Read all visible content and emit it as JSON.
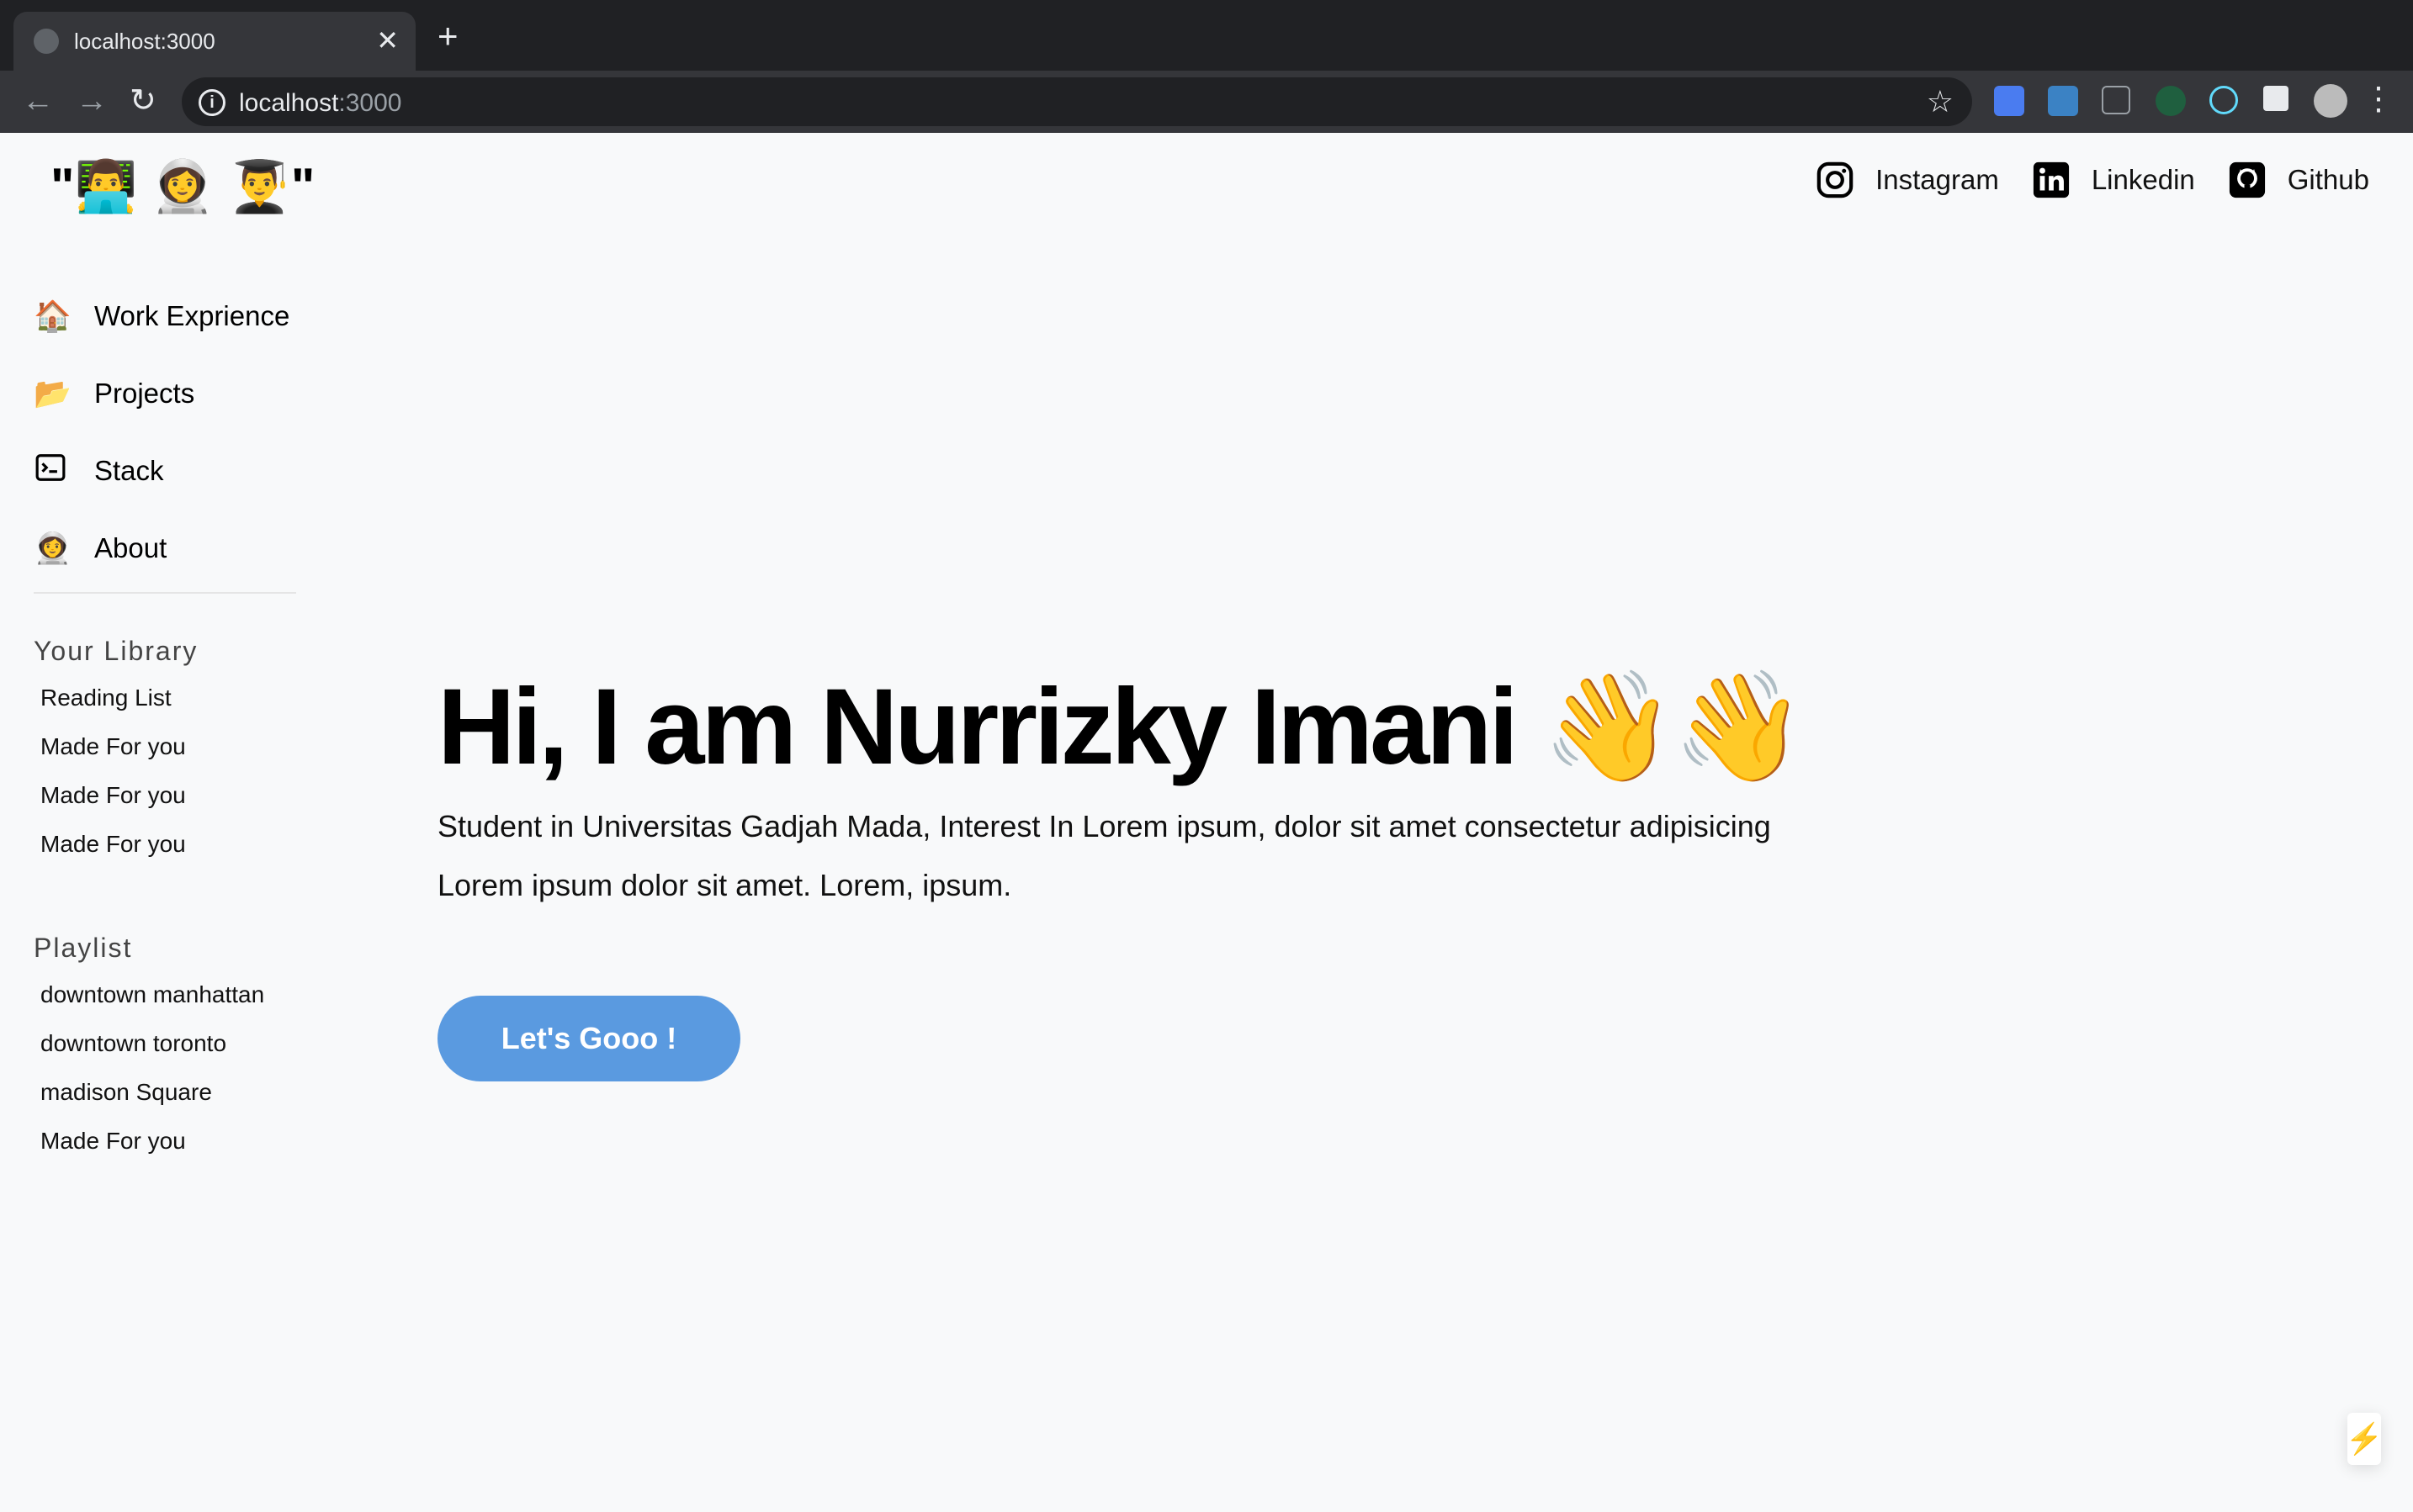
{
  "browser": {
    "tab_title": "localhost:3000",
    "tab_close": "✕",
    "new_tab": "+",
    "url_host": "localhost",
    "url_port": ":3000",
    "back_icon": "←",
    "forward_icon": "→",
    "reload_icon": "↻",
    "info_icon": "i",
    "star_icon": "☆",
    "menu_icon": "⋮"
  },
  "logo": {
    "open_quote": "\"",
    "emojis": "👨‍💻 👩‍🚀 👨‍🎓",
    "close_quote": "\""
  },
  "socials": [
    {
      "label": "Instagram",
      "icon": "instagram-icon"
    },
    {
      "label": "Linkedin",
      "icon": "linkedin-icon"
    },
    {
      "label": "Github",
      "icon": "github-icon"
    }
  ],
  "nav": [
    {
      "emoji": "🏠",
      "label": "Work Exprience"
    },
    {
      "emoji": "📂",
      "label": "Projects"
    },
    {
      "emoji": "⌨",
      "label": "Stack"
    },
    {
      "emoji": "👩‍🚀",
      "label": "About"
    }
  ],
  "library": {
    "title": "Your Library",
    "items": [
      "Reading List",
      "Made For you",
      "Made For you",
      "Made For you"
    ]
  },
  "playlist": {
    "title": "Playlist",
    "items": [
      "downtown manhattan",
      "downtown toronto",
      "madison Square",
      "Made For you"
    ]
  },
  "hero": {
    "title": "Hi, I am Nurrizky Imani 👋👋",
    "line1": "Student in Universitas Gadjah Mada, Interest In Lorem ipsum, dolor sit amet consectetur adipisicing",
    "line2": "Lorem ipsum dolor sit amet. Lorem, ipsum.",
    "cta": "Let's Gooo !"
  },
  "badge": {
    "icon": "⚡"
  },
  "colors": {
    "cta": "#5a9ae0",
    "background": "#f8f9fa",
    "chrome": "#202124"
  }
}
